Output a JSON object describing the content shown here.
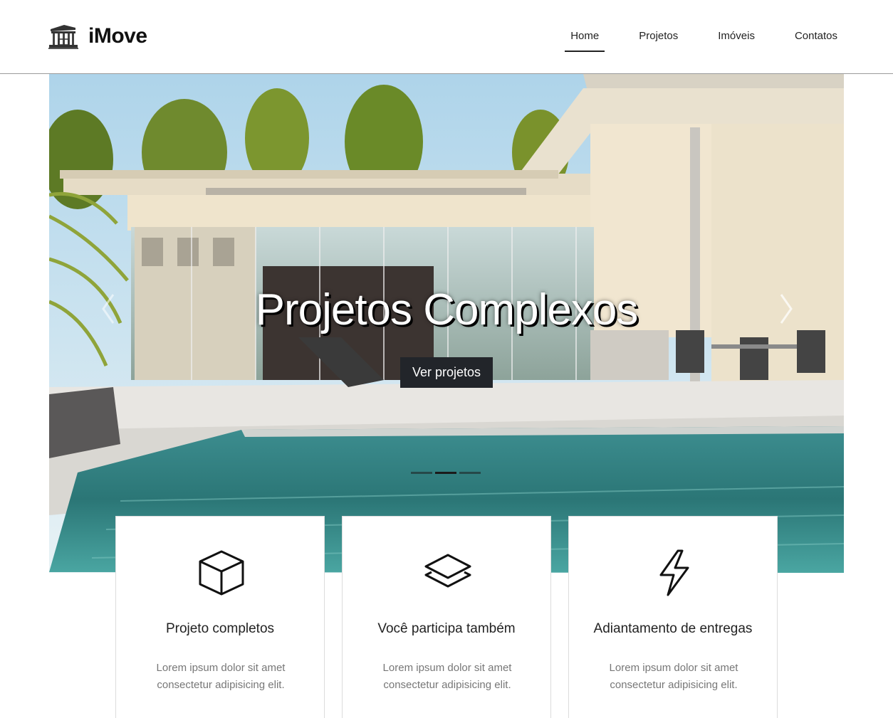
{
  "brand": {
    "name": "iMove",
    "icon": "building-icon"
  },
  "nav": {
    "items": [
      {
        "label": "Home",
        "active": true
      },
      {
        "label": "Projetos",
        "active": false
      },
      {
        "label": "Imóveis",
        "active": false
      },
      {
        "label": "Contatos",
        "active": false
      }
    ]
  },
  "hero": {
    "title": "Projetos Complexos",
    "button_label": "Ver projetos",
    "slides": 3,
    "active_slide": 2,
    "prev_icon": "chevron-left-icon",
    "next_icon": "chevron-right-icon"
  },
  "features": [
    {
      "icon": "cube-icon",
      "title": "Projeto completos",
      "text": "Lorem ipsum dolor sit amet consectetur adipisicing elit."
    },
    {
      "icon": "layers-icon",
      "title": "Você participa também",
      "text": "Lorem ipsum dolor sit amet consectetur adipisicing elit."
    },
    {
      "icon": "lightning-icon",
      "title": "Adiantamento de entregas",
      "text": "Lorem ipsum dolor sit amet consectetur adipisicing elit."
    }
  ],
  "colors": {
    "button_bg": "#22252a",
    "text": "#222222",
    "muted": "#777777",
    "divider": "#9a9a9a"
  }
}
